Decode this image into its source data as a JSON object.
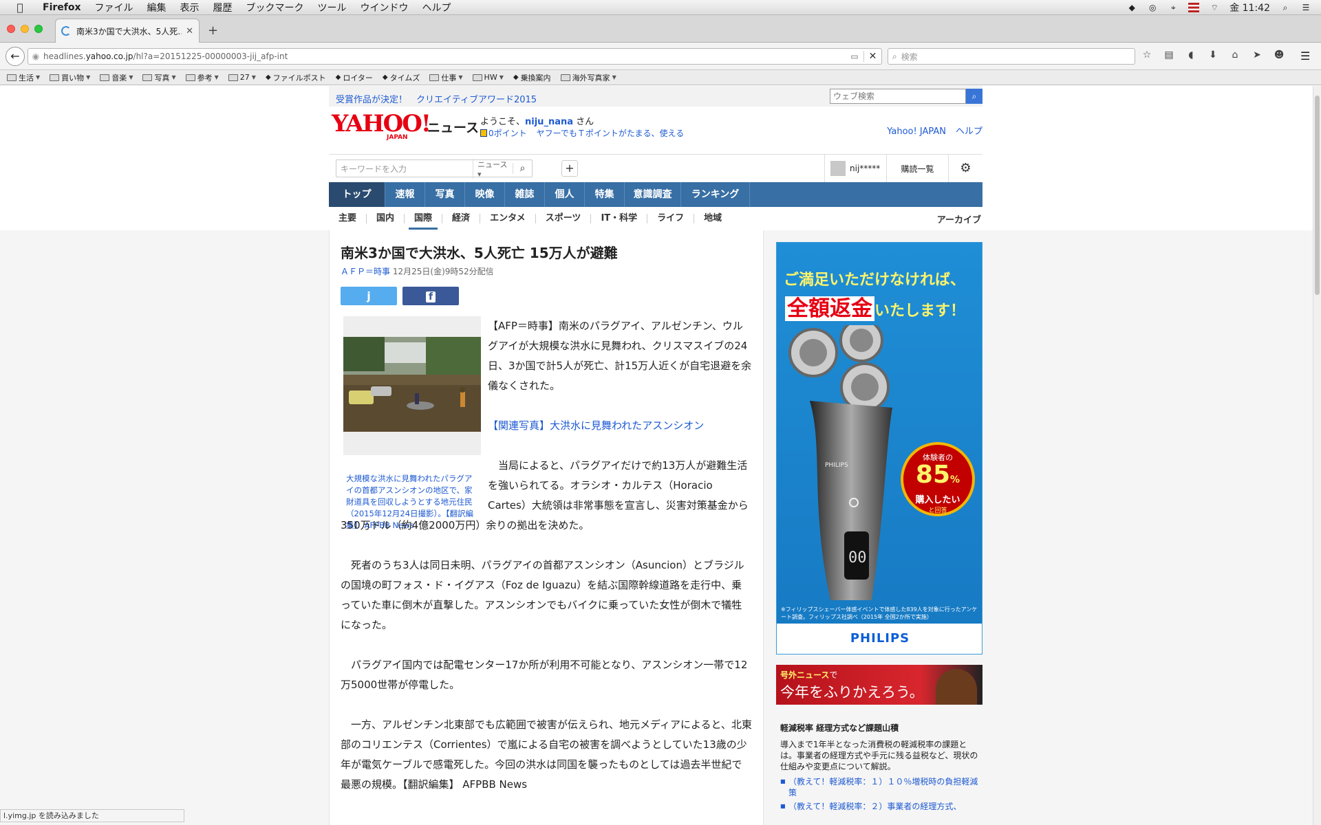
{
  "menubar": {
    "app": "Firefox",
    "items": [
      "ファイル",
      "編集",
      "表示",
      "履歴",
      "ブックマーク",
      "ツール",
      "ウインドウ",
      "ヘルプ"
    ],
    "clock": "金 11:42"
  },
  "browser": {
    "tab_title": "南米3か国で大洪水、5人死…",
    "url_host": "headlines.yahoo.co.jp",
    "url_path": "/hl?a=20151225-00000003-jij_afp-int",
    "url_prefix": "headlines.",
    "url_domain": "yahoo.co.jp",
    "search_placeholder": "検索",
    "status_text": "l.yimg.jp を読み込みました"
  },
  "bookmarks": [
    {
      "label": "生活",
      "type": "folder"
    },
    {
      "label": "買い物",
      "type": "folder"
    },
    {
      "label": "音楽",
      "type": "folder"
    },
    {
      "label": "写真",
      "type": "folder"
    },
    {
      "label": "参考",
      "type": "folder"
    },
    {
      "label": "27",
      "type": "folder"
    },
    {
      "label": "ファイルポスト",
      "type": "link"
    },
    {
      "label": "ロイター",
      "type": "link"
    },
    {
      "label": "タイムズ",
      "type": "link"
    },
    {
      "label": "仕事",
      "type": "folder"
    },
    {
      "label": "HW",
      "type": "folder"
    },
    {
      "label": "乗換案内",
      "type": "link"
    },
    {
      "label": "海外写真家",
      "type": "folder"
    }
  ],
  "promo": {
    "link": "受賞作品が決定！　クリエイティブアワード2015",
    "websearch_placeholder": "ウェブ検索"
  },
  "header": {
    "logo": "YAHOO!",
    "logo_sub": "JAPAN",
    "section": "ニュース",
    "welcome_pre": "ようこそ、",
    "username": "niju_nana",
    "welcome_post": " さん",
    "points": "0ポイント",
    "slogan": "ヤフーでもＴポイントがたまる、使える",
    "link_top": "Yahoo! JAPAN",
    "link_help": "ヘルプ"
  },
  "search": {
    "placeholder": "キーワードを入力",
    "scope": "ニュース",
    "account": "nij*****",
    "subscriptions": "購読一覧"
  },
  "global_nav": [
    "トップ",
    "速報",
    "写真",
    "映像",
    "雑誌",
    "個人",
    "特集",
    "意識調査",
    "ランキング"
  ],
  "sub_nav": [
    "主要",
    "国内",
    "国際",
    "経済",
    "エンタメ",
    "スポーツ",
    "IT・科学",
    "ライフ",
    "地域"
  ],
  "sub_nav_archive": "アーカイブ",
  "article": {
    "headline": "南米3か国で大洪水、5人死亡 15万人が避難",
    "source": "ＡＦＰ＝時事",
    "date": "12月25日(金)9時52分配信",
    "caption": "大規模な洪水に見舞われたパラグアイの首都アスンシオンの地区で、家財道具を回収しようとする地元住民（2015年12月24日撮影）。【翻訳編集】 AFPBB News",
    "p1": "【AFP＝時事】南米のパラグアイ、アルゼンチン、ウルグアイが大規模な洪水に見舞われ、クリスマスイブの24日、3か国で計5人が死亡、計15万人近くが自宅退避を余儀なくされた。",
    "related": "【関連写真】大洪水に見舞われたアスンシオン",
    "p2": "当局によると、パラグアイだけで約13万人が避難生活を強いられてる。オラシオ・カルテス（Horacio Cartes）大統領は非常事態を宣言し、災害対策基金から350万ドル（約4億2000万円）余りの拠出を決めた。",
    "p3": "死者のうち3人は同日未明、パラグアイの首都アスンシオン（Asuncion）とブラジルの国境の町フォス・ド・イグアス（Foz de Iguazu）を結ぶ国際幹線道路を走行中、乗っていた車に倒木が直撃した。アスンシオンでもバイクに乗っていた女性が倒木で犠牲になった。",
    "p4": "パラグアイ国内では配電センター17か所が利用不可能となり、アスンシオン一帯で12万5000世帯が停電した。",
    "p5": "一方、アルゼンチン北東部でも広範囲で被害が伝えられ、地元メディアによると、北東部のコリエンテス（Corrientes）で嵐による自宅の被害を調べようとしていた13歳の少年が電気ケーブルで感電死した。今回の洪水は同国を襲ったものとしては過去半世紀で最悪の規模。【翻訳編集】 AFPBB News"
  },
  "ad": {
    "line1": "ご満足いただけなければ、",
    "line2_em": "全額返金",
    "line2_rest": "いたします！",
    "seal_a": "体験者の",
    "seal_b": "85",
    "seal_pct": "%",
    "seal_c": "購入したい",
    "seal_d": "と回答",
    "fine": "※フィリップスシェーバー体感イベントで体感した839人を対象に行ったアンケート調査。フィリップス社調べ（2015年 全国2か所で実施）",
    "brand": "PHILIPS",
    "device_label": "PHILIPS"
  },
  "banner2": {
    "pre": "号外ニュース",
    "post": "で",
    "main": "今年をふりかえろう。"
  },
  "topic": {
    "title": "軽減税率 経理方式など課題山積",
    "desc": "導入まで1年半となった消費税の軽減税率の課題とは。事業者の経理方式や手元に残る益税など、現状の仕組みや変更点について解説。",
    "items": [
      "（教えて！軽減税率：１）１０％増税時の負担軽減策",
      "（教えて！軽減税率：２）事業者の経理方式、"
    ]
  },
  "colors": {
    "yahoo_red": "#e60012",
    "nav_blue": "#386fa4",
    "link_blue": "#1e5ad2",
    "twitter": "#55acee",
    "facebook": "#3b5998"
  }
}
